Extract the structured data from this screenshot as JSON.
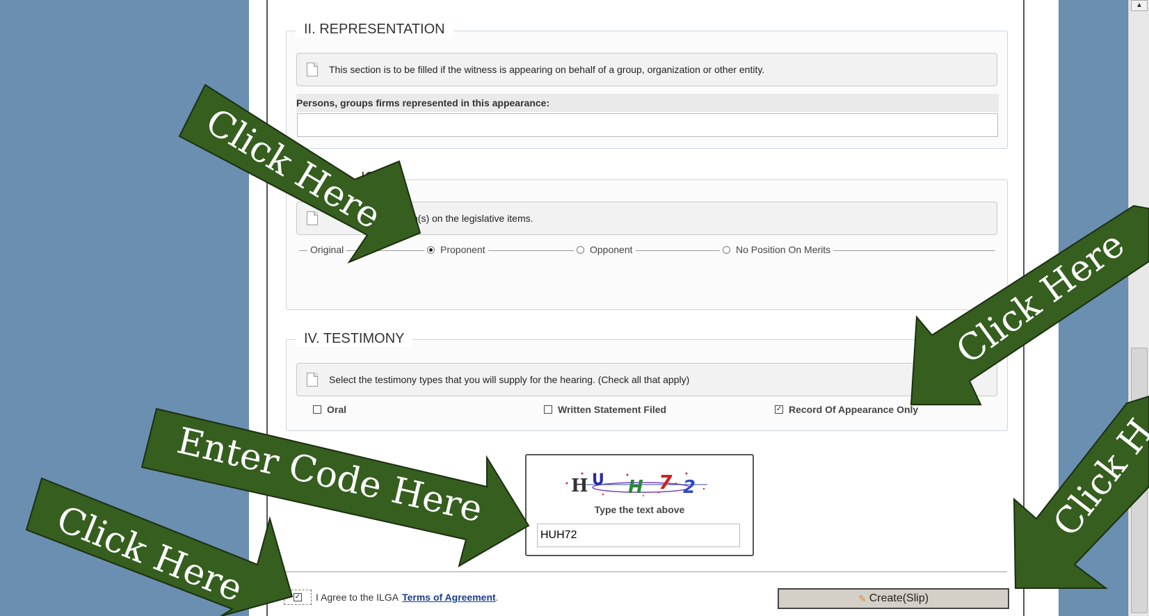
{
  "sections": {
    "representation": {
      "legend": "II. REPRESENTATION",
      "info": "This section is to be filled if the witness is appearing on behalf of a group, organization or other entity.",
      "field_label": "Persons, groups firms represented in this appearance:",
      "field_value": ""
    },
    "position": {
      "legend_partial": "IO",
      "info_partial": "n(s) on the legislative items.",
      "row_label": "Original",
      "options": [
        "Proponent",
        "Opponent",
        "No Position On Merits"
      ],
      "selected": "Proponent"
    },
    "testimony": {
      "legend": "IV. TESTIMONY",
      "info": "Select the testimony types that you will supply for the hearing. (Check all that apply)",
      "options": [
        {
          "label": "Oral",
          "checked": false
        },
        {
          "label": "Written Statement Filed",
          "checked": false
        },
        {
          "label": "Record Of Appearance Only",
          "checked": true
        }
      ]
    }
  },
  "captcha": {
    "image_text": "HUH72",
    "hint": "Type the text above",
    "value": "HUH72"
  },
  "agreement": {
    "prefix": "I Agree to the ILGA",
    "link": "Terms of Agreement",
    "suffix": ".",
    "checked": true
  },
  "create_button": "Create(Slip)",
  "annotations": {
    "click_here": "Click Here",
    "click_partial": "Click H",
    "enter_code": "Enter Code Here",
    "arrow_color": "#355e1f"
  }
}
